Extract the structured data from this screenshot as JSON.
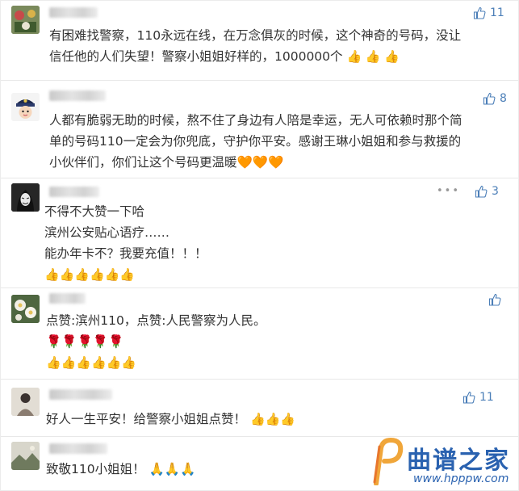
{
  "comments": [
    {
      "text": "有困难找警察，110永远在线，在万念俱灰的时候，这个神奇的号码，没让\n信任他的人们失望！警察小姐姐好样的，1000000个",
      "emojis": "👍 👍 👍",
      "likes": "11",
      "avatar_icon": "plants-photo-avatar"
    },
    {
      "text": "人都有脆弱无助的时候，熬不住了身边有人陪是幸运，无人可依赖时那个简\n单的号码110一定会为你兜底，守护你平安。感谢王琳小姐姐和参与救援的\n小伙伴们，你们让这个号码更温暖",
      "emojis": "🧡🧡🧡",
      "likes": "8",
      "avatar_icon": "police-cartoon-avatar"
    },
    {
      "text": "不得不大赞一下哈\n滨州公安贴心语疗……\n能办年卡不？我要充值！！！",
      "emojis": "👍👍👍👍👍👍",
      "likes": "3",
      "avatar_icon": "masked-figure-avatar"
    },
    {
      "text": "点赞:滨州110，点赞:人民警察为人民。",
      "emojis_line1": "🌹🌹🌹🌹🌹",
      "emojis_line2": "👍👍👍👍👍👍",
      "likes": "",
      "avatar_icon": "flowers-photo-avatar"
    },
    {
      "text": "好人一生平安！给警察小姐姐点赞！",
      "emojis": "👍👍👍",
      "likes": "11",
      "avatar_icon": "person-photo-avatar"
    },
    {
      "text": "致敬110小姐姐！",
      "emojis": "🙏🙏🙏",
      "likes": "",
      "avatar_icon": "landscape-photo-avatar"
    }
  ],
  "more_label": "•••",
  "watermark": {
    "name": "曲谱之家",
    "url": "www.hpppw.com"
  },
  "colors": {
    "link": "#4c7fb8",
    "text": "#333333",
    "meta": "#999999",
    "brand": "#2a62b0"
  }
}
